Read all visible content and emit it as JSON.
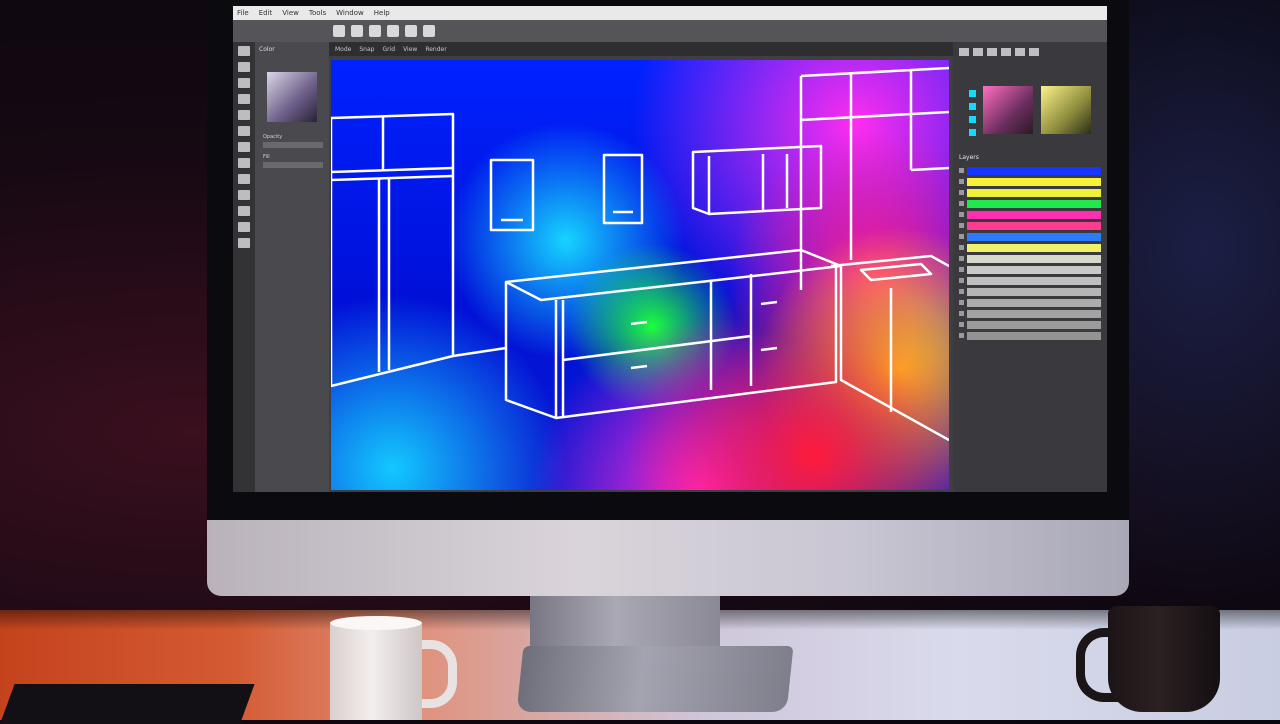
{
  "app": {
    "menu": [
      "File",
      "Edit",
      "View",
      "Tools",
      "Window",
      "Help"
    ],
    "options_bar": [
      "Mode",
      "Snap",
      "Grid",
      "View",
      "Render"
    ],
    "left_panel": {
      "title": "Color",
      "rows": [
        "Opacity",
        "Fill"
      ]
    },
    "right_panel": {
      "layers_title": "Layers"
    }
  },
  "layers": [
    {
      "color": "#1736ff"
    },
    {
      "color": "#f6f23a"
    },
    {
      "color": "#eef13c"
    },
    {
      "color": "#21e84c"
    },
    {
      "color": "#ff2fb2"
    },
    {
      "color": "#ff3d90"
    },
    {
      "color": "#2b7bff"
    },
    {
      "color": "#f1f06a"
    },
    {
      "color": "#d8d8c8"
    },
    {
      "color": "#c9c9c9"
    },
    {
      "color": "#bfbfbf"
    },
    {
      "color": "#b5b5b5"
    },
    {
      "color": "#acacac"
    },
    {
      "color": "#a3a3a3"
    },
    {
      "color": "#9b9b9b"
    },
    {
      "color": "#939393"
    }
  ],
  "colors": {
    "accent_cyan": "#17d8ff",
    "wireframe": "#ffffff"
  }
}
